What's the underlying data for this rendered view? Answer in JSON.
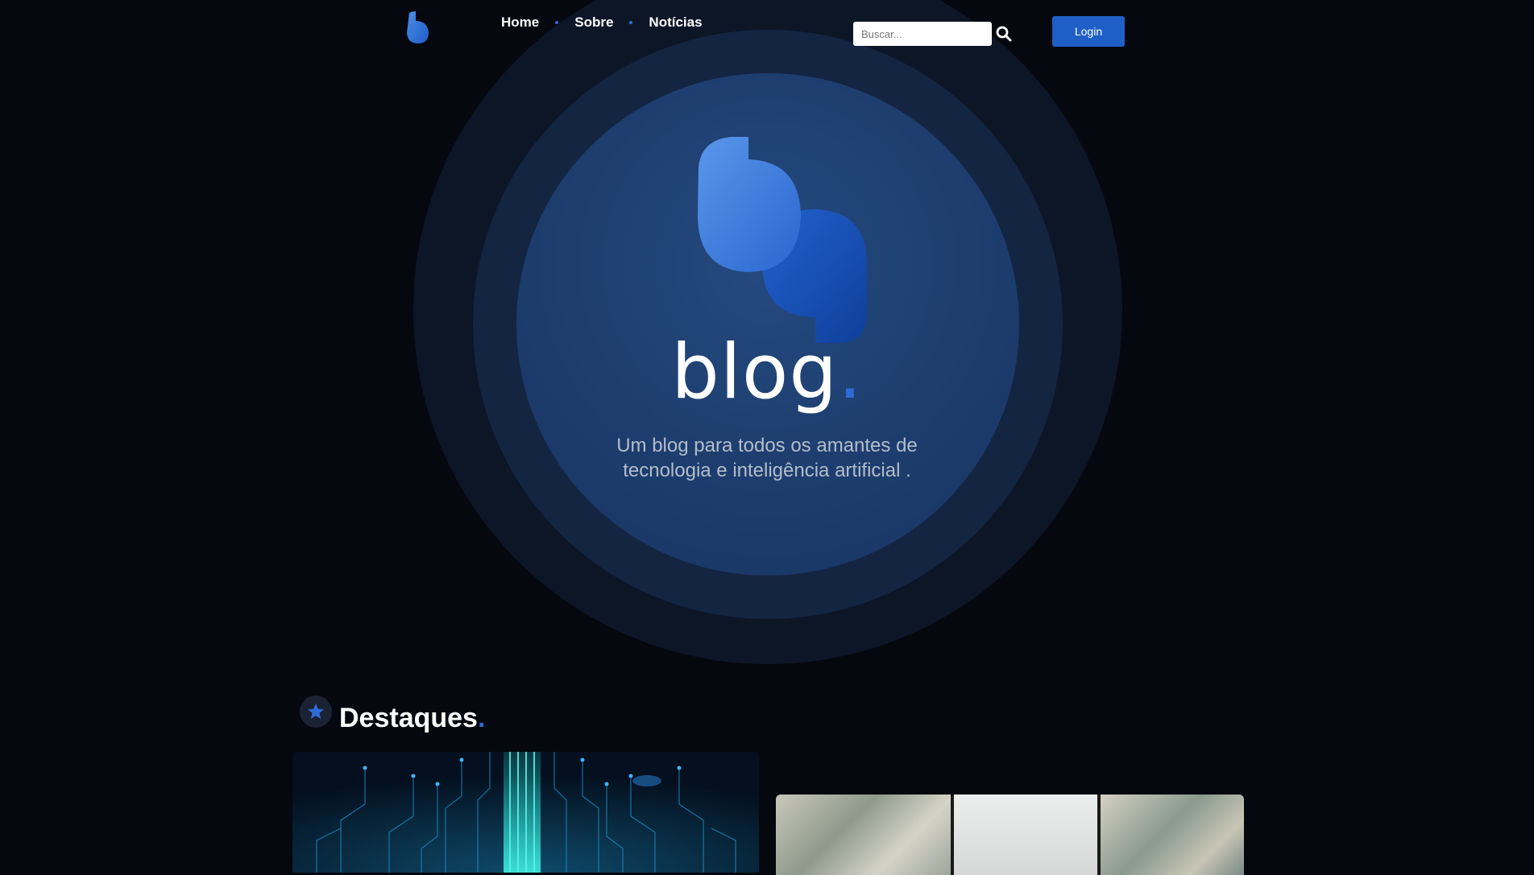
{
  "header": {
    "nav": [
      {
        "label": "Home"
      },
      {
        "label": "Sobre"
      },
      {
        "label": "Notícias"
      }
    ],
    "search": {
      "placeholder": "Buscar..."
    },
    "login_label": "Login"
  },
  "hero": {
    "title": "blog",
    "title_dot": ".",
    "subtitle": "Um blog para todos os amantes de tecnologia e inteligência artificial ."
  },
  "featured": {
    "title": "Destaques",
    "title_dot": "."
  },
  "colors": {
    "background": "#05080f",
    "accent": "#2f6ad8",
    "login_button": "#1f5fc7"
  },
  "icons": [
    "logo-icon",
    "search-icon",
    "star-icon"
  ]
}
